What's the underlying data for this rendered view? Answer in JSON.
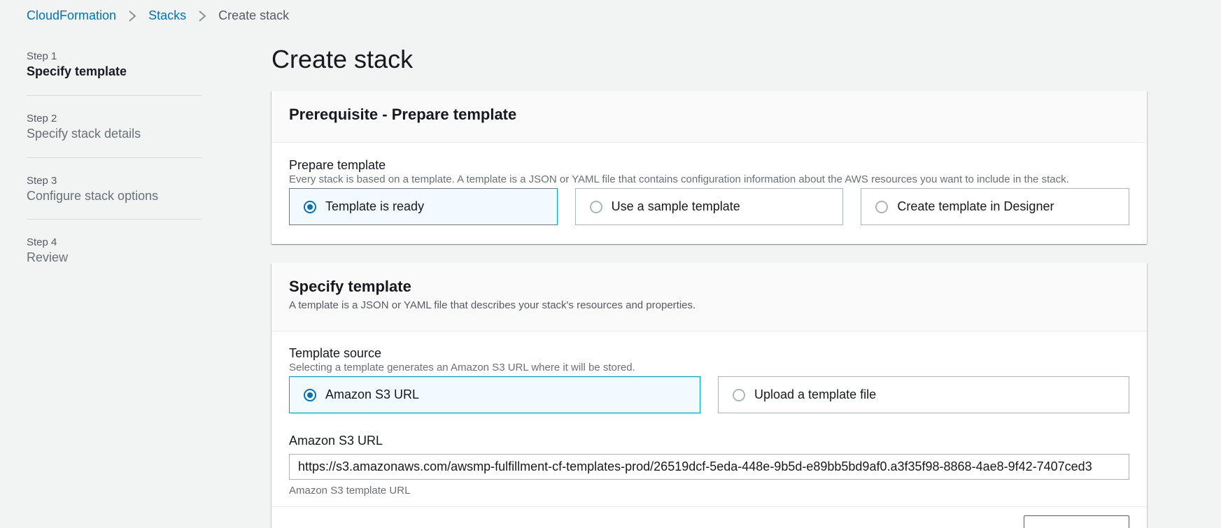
{
  "breadcrumb": {
    "items": [
      "CloudFormation",
      "Stacks"
    ],
    "current": "Create stack"
  },
  "sidenav": {
    "steps": [
      {
        "num": "Step 1",
        "title": "Specify template"
      },
      {
        "num": "Step 2",
        "title": "Specify stack details"
      },
      {
        "num": "Step 3",
        "title": "Configure stack options"
      },
      {
        "num": "Step 4",
        "title": "Review"
      }
    ]
  },
  "page": {
    "title": "Create stack"
  },
  "prerequisite": {
    "heading": "Prerequisite - Prepare template",
    "label": "Prepare template",
    "description": "Every stack is based on a template. A template is a JSON or YAML file that contains configuration information about the AWS resources you want to include in the stack.",
    "options": [
      "Template is ready",
      "Use a sample template",
      "Create template in Designer"
    ],
    "selected": "Template is ready"
  },
  "specify": {
    "heading": "Specify template",
    "description": "A template is a JSON or YAML file that describes your stack's resources and properties.",
    "source_label": "Template source",
    "source_description": "Selecting a template generates an Amazon S3 URL where it will be stored.",
    "options": [
      "Amazon S3 URL",
      "Upload a template file"
    ],
    "selected": "Amazon S3 URL",
    "url_label": "Amazon S3 URL",
    "url_value": "https://s3.amazonaws.com/awsmp-fulfillment-cf-templates-prod/26519dcf-5eda-448e-9b5d-e89bb5bd9af0.a3f35f98-8868-4ae8-9f42-7407ced3",
    "url_constraint": "Amazon S3 template URL"
  },
  "colors": {
    "link": "#0073bb",
    "selected_border": "#00a1c9",
    "selected_bg": "#f1faff",
    "background": "#f2f3f3"
  }
}
